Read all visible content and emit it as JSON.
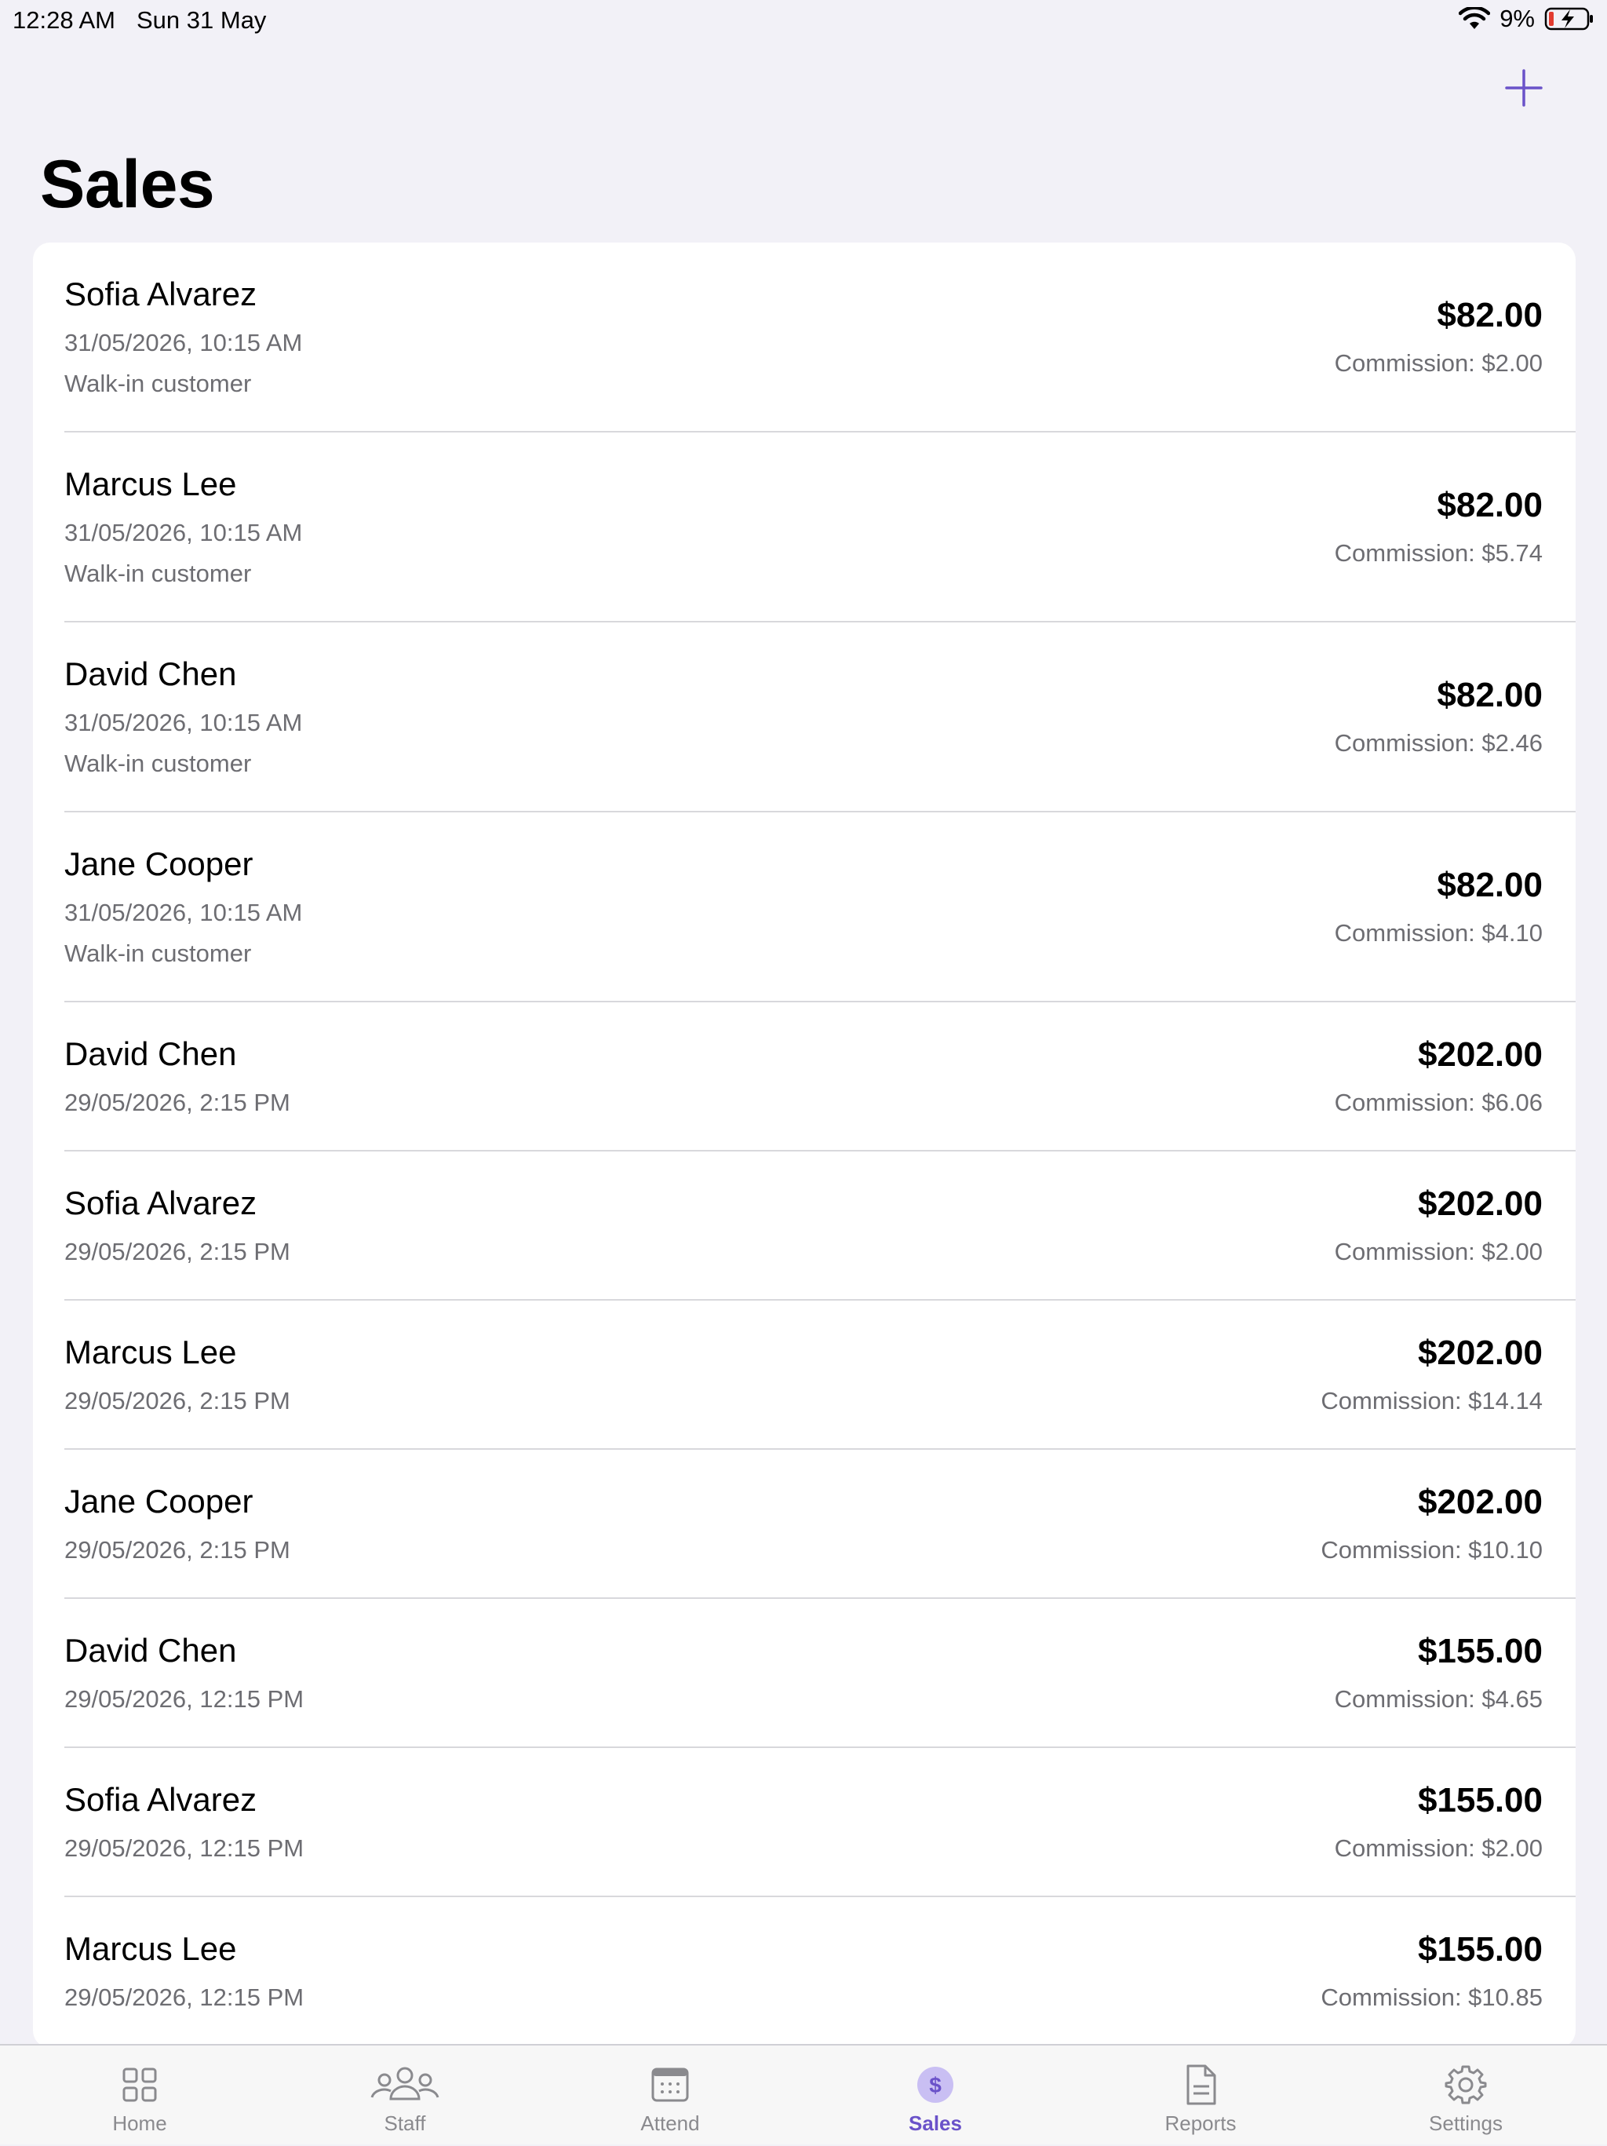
{
  "status_bar": {
    "time": "12:28 AM",
    "date": "Sun 31 May",
    "battery": "9%"
  },
  "header": {
    "title": "Sales",
    "add_icon": "plus-icon"
  },
  "sales": [
    {
      "name": "Sofia Alvarez",
      "date": "31/05/2026, 10:15 AM",
      "note": "Walk-in customer",
      "amount": "$82.00",
      "commission": "Commission: $2.00"
    },
    {
      "name": "Marcus Lee",
      "date": "31/05/2026, 10:15 AM",
      "note": "Walk-in customer",
      "amount": "$82.00",
      "commission": "Commission: $5.74"
    },
    {
      "name": "David Chen",
      "date": "31/05/2026, 10:15 AM",
      "note": "Walk-in customer",
      "amount": "$82.00",
      "commission": "Commission: $2.46"
    },
    {
      "name": "Jane Cooper",
      "date": "31/05/2026, 10:15 AM",
      "note": "Walk-in customer",
      "amount": "$82.00",
      "commission": "Commission: $4.10"
    },
    {
      "name": "David Chen",
      "date": "29/05/2026, 2:15 PM",
      "amount": "$202.00",
      "commission": "Commission: $6.06"
    },
    {
      "name": "Sofia Alvarez",
      "date": "29/05/2026, 2:15 PM",
      "amount": "$202.00",
      "commission": "Commission: $2.00"
    },
    {
      "name": "Marcus Lee",
      "date": "29/05/2026, 2:15 PM",
      "amount": "$202.00",
      "commission": "Commission: $14.14"
    },
    {
      "name": "Jane Cooper",
      "date": "29/05/2026, 2:15 PM",
      "amount": "$202.00",
      "commission": "Commission: $10.10"
    },
    {
      "name": "David Chen",
      "date": "29/05/2026, 12:15 PM",
      "amount": "$155.00",
      "commission": "Commission: $4.65"
    },
    {
      "name": "Sofia Alvarez",
      "date": "29/05/2026, 12:15 PM",
      "amount": "$155.00",
      "commission": "Commission: $2.00"
    },
    {
      "name": "Marcus Lee",
      "date": "29/05/2026, 12:15 PM",
      "amount": "$155.00",
      "commission": "Commission: $10.85"
    }
  ],
  "tabs": [
    {
      "label": "Home",
      "icon": "grid-icon",
      "active": false
    },
    {
      "label": "Staff",
      "icon": "people-icon",
      "active": false
    },
    {
      "label": "Attend",
      "icon": "calendar-icon",
      "active": false
    },
    {
      "label": "Sales",
      "icon": "dollar-icon",
      "active": true
    },
    {
      "label": "Reports",
      "icon": "document-icon",
      "active": false
    },
    {
      "label": "Settings",
      "icon": "gear-icon",
      "active": false
    }
  ],
  "colors": {
    "accent": "#6a52c9",
    "background": "#f2f1f7",
    "secondary_text": "#6d6d72"
  }
}
